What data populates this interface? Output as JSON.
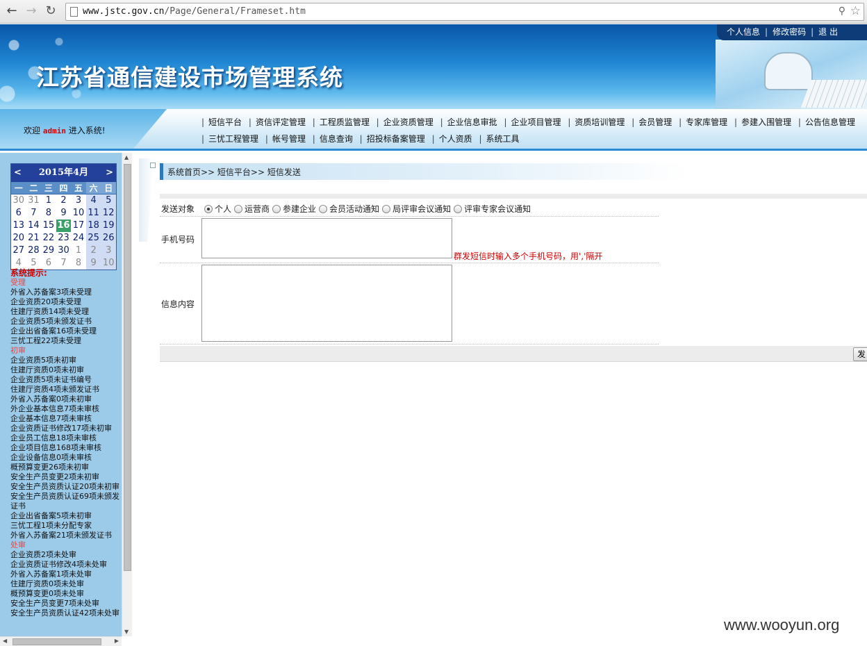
{
  "browser": {
    "url_host": "www.jstc.gov.cn",
    "url_path": "/Page/General/Frameset.htm"
  },
  "header": {
    "title": "江苏省通信建设市场管理系统",
    "links": [
      "个人信息",
      "修改密码",
      "退 出"
    ]
  },
  "welcome": {
    "prefix": "欢迎",
    "user": "admin",
    "suffix": "进入系统!"
  },
  "menu": {
    "row1": [
      "短信平台",
      "资信评定管理",
      "工程质监管理",
      "企业资质管理",
      "企业信息审批",
      "企业项目管理",
      "资质培训管理",
      "会员管理",
      "专家库管理",
      "参建入围管理",
      "公告信息管理"
    ],
    "row2": [
      "三忧工程管理",
      "帐号管理",
      "信息查询",
      "招投标备案管理",
      "个人资质",
      "系统工具"
    ]
  },
  "calendar": {
    "prev": "<",
    "next": ">",
    "title": "2015年4月",
    "weekdays": [
      "一",
      "二",
      "三",
      "四",
      "五",
      "六",
      "日"
    ],
    "weeks": [
      [
        "30",
        "31",
        "1",
        "2",
        "3",
        "4",
        "5"
      ],
      [
        "6",
        "7",
        "8",
        "9",
        "10",
        "11",
        "12"
      ],
      [
        "13",
        "14",
        "15",
        "16",
        "17",
        "18",
        "19"
      ],
      [
        "20",
        "21",
        "22",
        "23",
        "24",
        "25",
        "26"
      ],
      [
        "27",
        "28",
        "29",
        "30",
        "1",
        "2",
        "3"
      ],
      [
        "4",
        "5",
        "6",
        "7",
        "8",
        "9",
        "10"
      ]
    ],
    "today": "16"
  },
  "tips": {
    "title": "系统提示:",
    "groups": [
      {
        "name": "受理",
        "items": [
          "外省入苏备案3项未受理",
          "企业资质20项未受理",
          "住建厅资质14项未受理",
          "企业资质5项未颁发证书",
          "企业出省备案16项未受理",
          "三忧工程22项未受理"
        ]
      },
      {
        "name": "初审",
        "items": [
          "企业资质5项未初审",
          "住建厅资质0项未初审",
          "企业资质5项未证书编号",
          "住建厅资质4项未颁发证书",
          "外省入苏备案0项未初审",
          "外企业基本信息7项未审核",
          "企业基本信息7项未审核",
          "企业资质证书修改17项未初审",
          "企业员工信息18项未审核",
          "企业项目信息168项未审核",
          "企业设备信息0项未审核",
          "概预算变更26项未初审",
          "安全生产员变更2项未初审",
          "安全生产员资质认证20项未初审",
          "安全生产员资质认证69项未颁发证书",
          "企业出省备案5项未初审",
          "三忧工程1项未分配专家",
          "外省入苏备案21项未颁发证书"
        ]
      },
      {
        "name": "处审",
        "items": [
          "企业资质2项未处审",
          "企业资质证书修改4项未处审",
          "外省入苏备案1项未处审",
          "住建厅资质0项未处审",
          "概预算变更0项未处审",
          "安全生产员变更7项未处审",
          "安全生产员资质认证42项未处审"
        ]
      }
    ]
  },
  "breadcrumb": "系统首页>> 短信平台>> 短信发送",
  "form": {
    "target_label": "发送对象",
    "targets": [
      "个人",
      "运营商",
      "参建企业",
      "会员活动通知",
      "局评审会议通知",
      "评审专家会议通知"
    ],
    "selected_target": "个人",
    "phone_label": "手机号码",
    "phone_value": "",
    "phone_hint": "群发短信时输入多个手机号码，用','隔开",
    "content_label": "信息内容",
    "content_value": "",
    "send_label": "发"
  },
  "watermark": "www.wooyun.org"
}
